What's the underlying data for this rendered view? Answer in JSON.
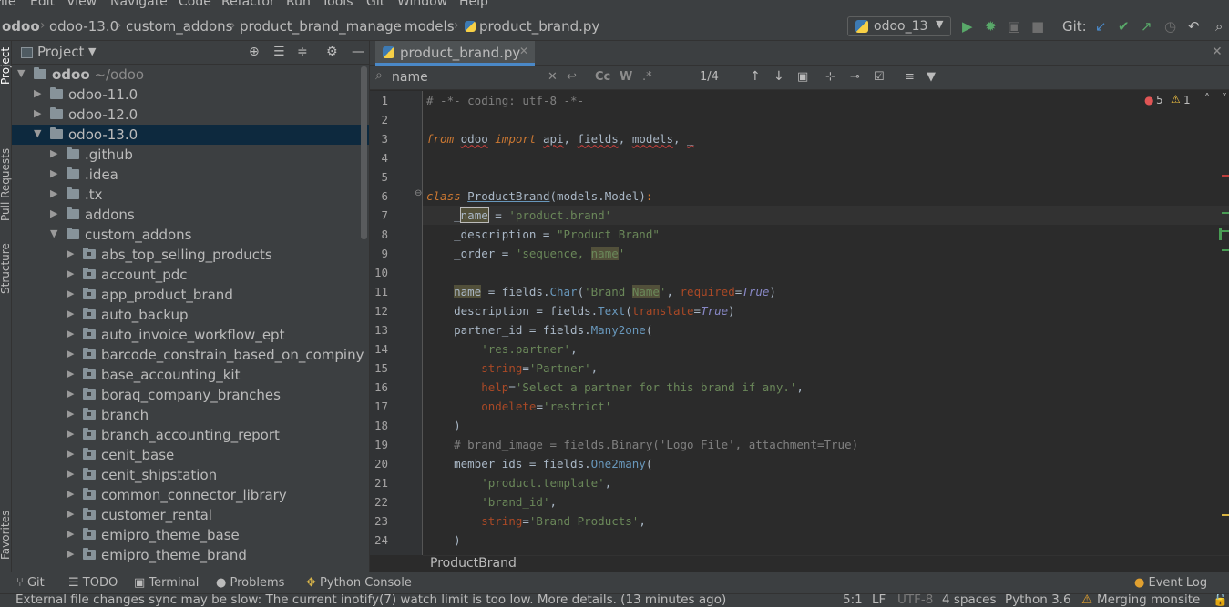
{
  "menubar": {
    "items": [
      "File",
      "Edit",
      "View",
      "Navigate",
      "Code",
      "Refactor",
      "Run",
      "Tools",
      "Git",
      "Window",
      "Help"
    ]
  },
  "navbar": {
    "breadcrumbs": [
      "odoo",
      "odoo-13.0",
      "custom_addons",
      "product_brand_manage",
      "models",
      "product_brand.py"
    ],
    "run_config": "odoo_13",
    "git_label": "Git:"
  },
  "stripe": {
    "project": "Project",
    "pull_requests": "Pull Requests",
    "structure": "Structure",
    "favorites": "Favorites"
  },
  "project": {
    "title": "Project",
    "root": {
      "name": "odoo",
      "path": "~/odoo"
    },
    "tree": [
      {
        "name": "odoo-11.0",
        "depth": 1,
        "expanded": false
      },
      {
        "name": "odoo-12.0",
        "depth": 1,
        "expanded": false
      },
      {
        "name": "odoo-13.0",
        "depth": 1,
        "expanded": true,
        "selected": true
      },
      {
        "name": ".github",
        "depth": 2,
        "expanded": false
      },
      {
        "name": ".idea",
        "depth": 2,
        "expanded": false
      },
      {
        "name": ".tx",
        "depth": 2,
        "expanded": false
      },
      {
        "name": "addons",
        "depth": 2,
        "expanded": false
      },
      {
        "name": "custom_addons",
        "depth": 2,
        "expanded": true
      },
      {
        "name": "abs_top_selling_products",
        "depth": 3,
        "expanded": false
      },
      {
        "name": "account_pdc",
        "depth": 3,
        "expanded": false
      },
      {
        "name": "app_product_brand",
        "depth": 3,
        "expanded": false
      },
      {
        "name": "auto_backup",
        "depth": 3,
        "expanded": false
      },
      {
        "name": "auto_invoice_workflow_ept",
        "depth": 3,
        "expanded": false
      },
      {
        "name": "barcode_constrain_based_on_compiny",
        "depth": 3,
        "expanded": false
      },
      {
        "name": "base_accounting_kit",
        "depth": 3,
        "expanded": false
      },
      {
        "name": "boraq_company_branches",
        "depth": 3,
        "expanded": false
      },
      {
        "name": "branch",
        "depth": 3,
        "expanded": false
      },
      {
        "name": "branch_accounting_report",
        "depth": 3,
        "expanded": false
      },
      {
        "name": "cenit_base",
        "depth": 3,
        "expanded": false
      },
      {
        "name": "cenit_shipstation",
        "depth": 3,
        "expanded": false
      },
      {
        "name": "common_connector_library",
        "depth": 3,
        "expanded": false
      },
      {
        "name": "customer_rental",
        "depth": 3,
        "expanded": false
      },
      {
        "name": "emipro_theme_base",
        "depth": 3,
        "expanded": false
      },
      {
        "name": "emipro_theme_brand",
        "depth": 3,
        "expanded": false
      }
    ]
  },
  "editor": {
    "tab": "product_brand.py",
    "find": {
      "query": "name",
      "count": "1/4",
      "cc": "Cc",
      "w": "W"
    },
    "inspections": {
      "errors": "5",
      "warnings": "1"
    },
    "line_numbers": [
      "1",
      "2",
      "3",
      "4",
      "5",
      "6",
      "7",
      "8",
      "9",
      "10",
      "11",
      "12",
      "13",
      "14",
      "15",
      "16",
      "17",
      "18",
      "19",
      "20",
      "21",
      "22",
      "23",
      "24"
    ],
    "breadcrumb": "ProductBrand"
  },
  "toolwindows": [
    "Git",
    "TODO",
    "Terminal",
    "Problems",
    "Python Console"
  ],
  "event_log": "Event Log",
  "status": {
    "message": "External file changes sync may be slow: The current inotify(7) watch limit is too low. More details. (13 minutes ago)",
    "position": "5:1",
    "line_sep": "LF",
    "encoding": "UTF-8",
    "indent": "4 spaces",
    "interpreter": "Python 3.6",
    "branch": "Merging monsite"
  },
  "colors": {
    "selection": "#0d293e",
    "accent": "#4a88c7",
    "run_green": "#59a869"
  }
}
